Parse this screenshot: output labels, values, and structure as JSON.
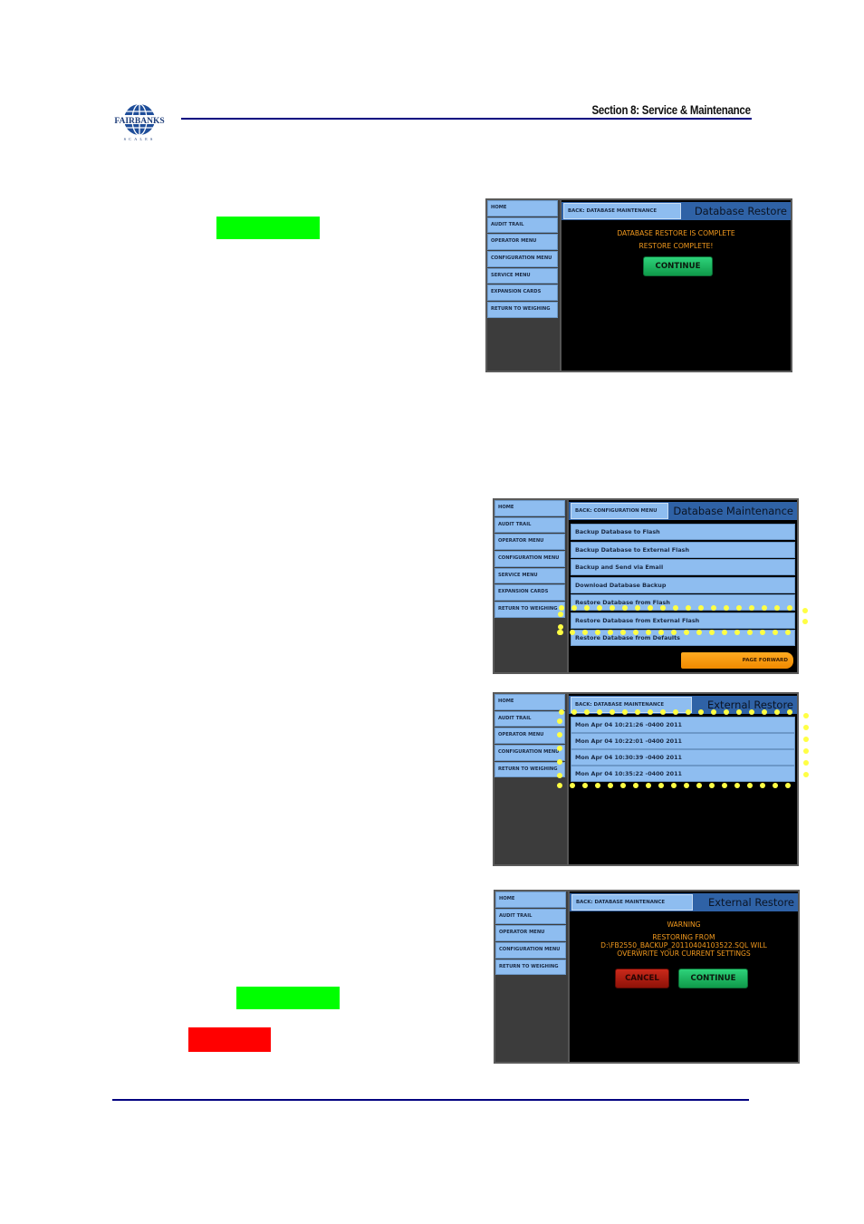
{
  "header": {
    "logo_text": "FAIRBANKS",
    "logo_subtext": "SCALES",
    "section_title": "Section 8:  Service & Maintenance"
  },
  "highlights": {
    "green": "#00ff00",
    "red": "#ff0000",
    "rule_color": "#000080"
  },
  "sidebar_full": [
    "HOME",
    "AUDIT TRAIL",
    "OPERATOR MENU",
    "CONFIGURATION MENU",
    "SERVICE MENU",
    "EXPANSION CARDS",
    "RETURN TO WEIGHING"
  ],
  "sidebar_short": [
    "HOME",
    "AUDIT TRAIL",
    "OPERATOR MENU",
    "CONFIGURATION MENU",
    "RETURN TO WEIGHING"
  ],
  "screen1": {
    "back_label": "BACK: DATABASE MAINTENANCE",
    "title": "Database Restore",
    "messages": [
      "DATABASE RESTORE IS COMPLETE",
      "RESTORE COMPLETE!"
    ],
    "continue_label": "CONTINUE"
  },
  "screen2": {
    "back_label": "BACK: CONFIGURATION MENU",
    "title": "Database Maintenance",
    "items": [
      "Backup Database to Flash",
      "Backup Database to External Flash",
      "Backup and Send via Email",
      "Download Database Backup",
      "Restore Database from Flash",
      "Restore Database from External Flash",
      "Restore Database from Defaults"
    ],
    "highlighted_item": "Restore Database from External Flash",
    "page_forward_label": "PAGE FORWARD"
  },
  "screen3": {
    "back_label": "BACK: DATABASE MAINTENANCE",
    "title": "External Restore",
    "backups": [
      "Mon Apr 04 10:21:26 -0400 2011",
      "Mon Apr 04 10:22:01 -0400 2011",
      "Mon Apr 04 10:30:39 -0400 2011",
      "Mon Apr 04 10:35:22 -0400 2011"
    ]
  },
  "screen4": {
    "back_label": "BACK: DATABASE MAINTENANCE",
    "title": "External Restore",
    "messages": [
      "WARNING",
      "RESTORING FROM",
      "D:\\FB2550_BACKUP_20110404103522.SQL WILL",
      "OVERWRITE YOUR CURRENT SETTINGS"
    ],
    "cancel_label": "CANCEL",
    "continue_label": "CONTINUE"
  }
}
